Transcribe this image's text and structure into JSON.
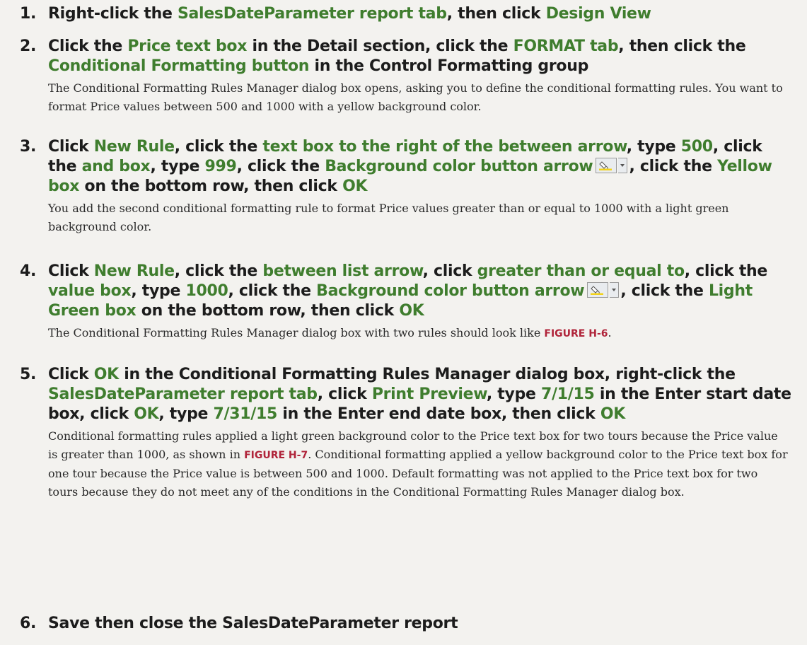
{
  "steps": [
    {
      "num": "1.",
      "head": [
        {
          "t": "Right-click the "
        },
        {
          "t": "SalesDateParameter report tab",
          "g": 1
        },
        {
          "t": ", then click "
        },
        {
          "t": "Design View",
          "g": 1
        }
      ],
      "desc": []
    },
    {
      "num": "2.",
      "head": [
        {
          "t": "Click the "
        },
        {
          "t": "Price text box",
          "g": 1
        },
        {
          "t": " in the Detail section, click the "
        },
        {
          "t": "FORMAT tab",
          "g": 1
        },
        {
          "t": ", then click the "
        },
        {
          "t": "Conditional Formatting button",
          "g": 1
        },
        {
          "t": " in the Control Formatting group"
        }
      ],
      "desc": [
        {
          "t": "The Conditional Formatting Rules Manager dialog box opens, asking you to define the conditional formatting rules. You want to format Price values between 500 and 1000 with a yellow background color."
        }
      ]
    },
    {
      "num": "3.",
      "head": [
        {
          "t": "Click "
        },
        {
          "t": "New Rule",
          "g": 1
        },
        {
          "t": ", click the "
        },
        {
          "t": "text box to the right of the between arrow",
          "g": 1
        },
        {
          "t": ", type "
        },
        {
          "t": "500",
          "g": 1
        },
        {
          "t": ", click the "
        },
        {
          "t": "and box",
          "g": 1
        },
        {
          "t": ", type "
        },
        {
          "t": "999",
          "g": 1
        },
        {
          "t": ", click the "
        },
        {
          "t": "Background color button arrow",
          "g": 1
        },
        {
          "icon": "background-color-icon"
        },
        {
          "t": ", click the "
        },
        {
          "t": "Yellow box",
          "g": 1
        },
        {
          "t": " on the bottom row, then click "
        },
        {
          "t": "OK",
          "g": 1
        }
      ],
      "desc": [
        {
          "t": "You add the second conditional formatting rule to format Price values greater than or equal to 1000 with a light green background color."
        }
      ]
    },
    {
      "num": "4.",
      "head": [
        {
          "t": "Click "
        },
        {
          "t": "New Rule",
          "g": 1
        },
        {
          "t": ", click the "
        },
        {
          "t": "between list arrow",
          "g": 1
        },
        {
          "t": ", click "
        },
        {
          "t": "greater than or equal to",
          "g": 1
        },
        {
          "t": ", click the "
        },
        {
          "t": "value box",
          "g": 1
        },
        {
          "t": ", type "
        },
        {
          "t": "1000",
          "g": 1
        },
        {
          "t": ", click the "
        },
        {
          "t": "Background color button arrow",
          "g": 1
        },
        {
          "icon": "background-color-icon"
        },
        {
          "t": ", click the "
        },
        {
          "t": "Light Green box",
          "g": 1
        },
        {
          "t": " on the bottom row, then click "
        },
        {
          "t": "OK",
          "g": 1
        }
      ],
      "desc": [
        {
          "t": "The Conditional Formatting Rules Manager dialog box with two rules should look like "
        },
        {
          "t": "FIGURE H-6",
          "fig": 1
        },
        {
          "t": "."
        }
      ]
    },
    {
      "num": "5.",
      "head": [
        {
          "t": "Click "
        },
        {
          "t": "OK",
          "g": 1
        },
        {
          "t": " in the Conditional Formatting Rules Manager dialog box, right-click the "
        },
        {
          "t": "SalesDateParameter report tab",
          "g": 1
        },
        {
          "t": ", click "
        },
        {
          "t": "Print Preview",
          "g": 1
        },
        {
          "t": ", type "
        },
        {
          "t": "7/1/15",
          "g": 1
        },
        {
          "t": " in the Enter start date box, click "
        },
        {
          "t": "OK",
          "g": 1
        },
        {
          "t": ", type "
        },
        {
          "t": "7/31/15",
          "g": 1
        },
        {
          "t": " in the Enter end date box, then click "
        },
        {
          "t": "OK",
          "g": 1
        }
      ],
      "desc": [
        {
          "t": "Conditional formatting rules applied a light green background color to the Price text box for two tours because the Price value is greater than 1000, as shown in "
        },
        {
          "t": "FIGURE H-7",
          "fig": 1
        },
        {
          "t": ". Conditional formatting applied a yellow background color to the Price text box for one tour because the Price value is between 500 and 1000. Default formatting was not applied to the Price text box for two tours because they do not meet any of the conditions in the Conditional Formatting Rules Manager dialog box."
        }
      ]
    },
    {
      "num": "6.",
      "head": [
        {
          "t": "Save then close the SalesDateParameter report"
        }
      ],
      "desc": []
    }
  ],
  "colors": {
    "accent_green": "#3f7d2e",
    "figure_ref_red": "#b0243a",
    "text": "#1c1c1c",
    "paper": "#f3f2ef"
  }
}
